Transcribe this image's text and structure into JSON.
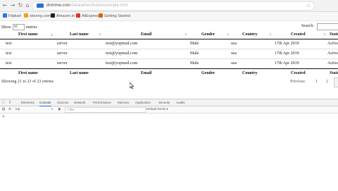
{
  "browser": {
    "back_glyph": "←",
    "forward_glyph": "→",
    "reload_glyph": "↻",
    "home_glyph": "⌂",
    "url_host": "dnmmw.com",
    "url_path": "/datatables/footerexample.html",
    "star_glyph": "☆"
  },
  "bookmarks": [
    {
      "label": "Flipkart",
      "color": "#2874f0"
    },
    {
      "label": "slooreg.com",
      "color": "#f0a21e"
    },
    {
      "label": "Amazon.in",
      "color": "#222222"
    },
    {
      "label": "AliExpress",
      "color": "#e43225"
    },
    {
      "label": "Getting Started",
      "color": "#e66000"
    }
  ],
  "table_controls": {
    "show_prefix": "Show",
    "entries_value": "10",
    "show_suffix": "entries",
    "search_label": "Search:"
  },
  "table": {
    "headers": [
      "First name",
      "Last name",
      "Email",
      "Gender",
      "Country",
      "Created",
      "Status"
    ],
    "footers": [
      "First name",
      "Last name",
      "Email",
      "Gender",
      "Country",
      "Created",
      "Status"
    ],
    "sort_glyph": "⇅",
    "sorted_glyph": "▲",
    "rows": [
      [
        "test",
        "server",
        "test@yopmail.com",
        "Male",
        "usa",
        "17th Apr 2019",
        "Active"
      ],
      [
        "test",
        "server",
        "test@yopmail.com",
        "Male",
        "usa",
        "17th Apr 2019",
        "Active"
      ],
      [
        "test",
        "server",
        "test@yopmail.com",
        "Male",
        "usa",
        "17th Apr 2019",
        "Active"
      ]
    ]
  },
  "footer": {
    "info": "Showing 21 to 23 of 23 entries",
    "previous": "Previous",
    "pages": [
      "1",
      "2"
    ]
  },
  "devtools": {
    "tabs": [
      "Elements",
      "Console",
      "Sources",
      "Network",
      "Performance",
      "Memory",
      "Application",
      "Security",
      "Audits"
    ],
    "active_tab": "Console",
    "context": "top",
    "filter_placeholder": "Filter",
    "levels": "Default levels ▾",
    "prompt": ">"
  }
}
